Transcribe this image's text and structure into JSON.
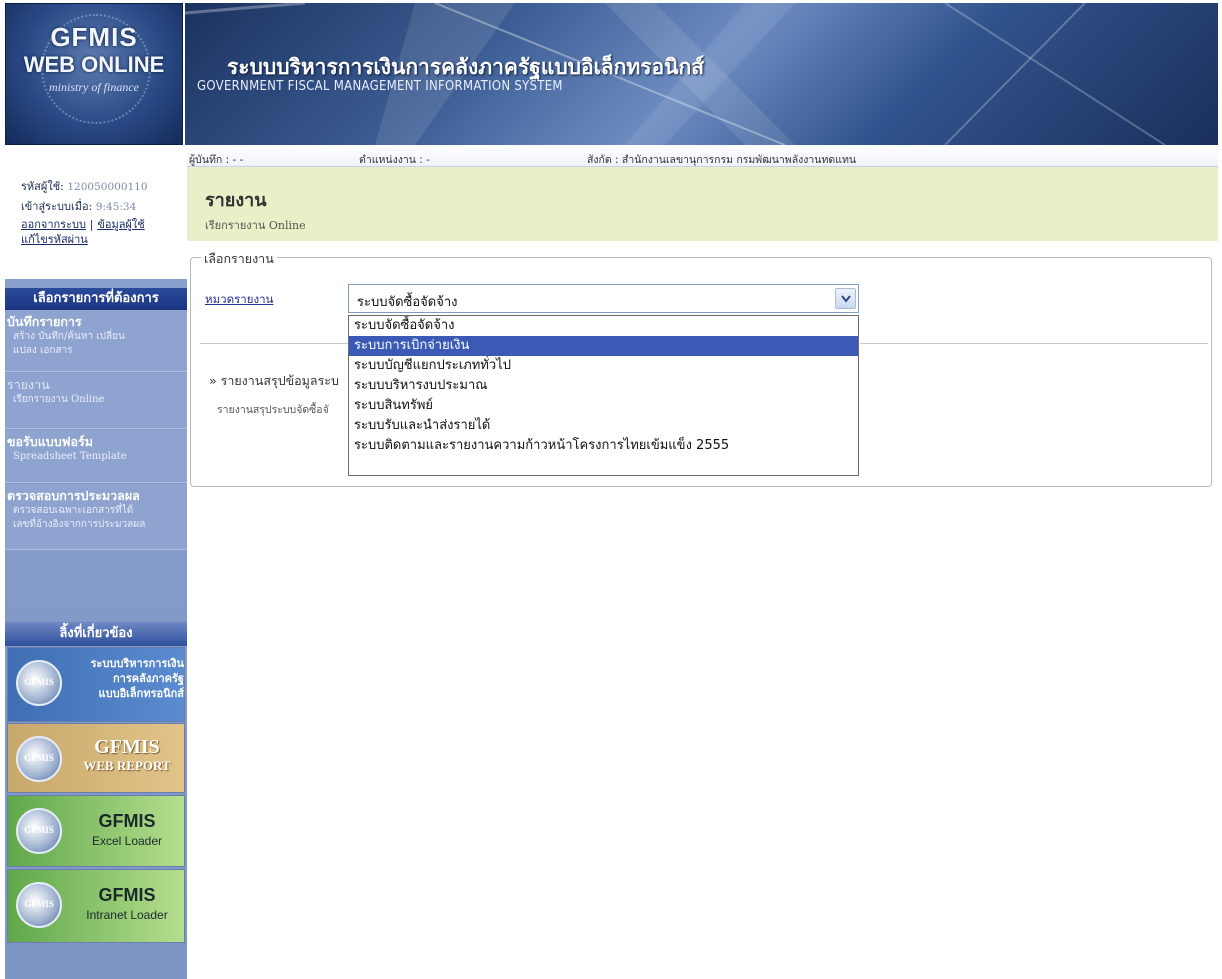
{
  "header": {
    "logo_line1": "GFMIS",
    "logo_line2": "WEB ONLINE",
    "logo_line3": "ministry of finance",
    "title_th": "ระบบบริหารการเงินการคลังภาครัฐแบบอิเล็กทรอนิกส์",
    "title_en": "GOVERNMENT FISCAL MANAGEMENT INFORMATION SYSTEM"
  },
  "user": {
    "user_id_label": "รหัสผู้ใช้:",
    "user_id": "120050000110",
    "login_time_label": "เข้าสู่ระบบเมื่อ:",
    "login_time": "9:45:34",
    "logout_link": "ออกจากระบบ",
    "separator": "|",
    "user_info_link": "ข้อมูลผู้ใช้",
    "change_password_link": "แก้ไขรหัสผ่าน"
  },
  "sidebar": {
    "menu_title": "เลือกรายการที่ต้องการ",
    "items": [
      {
        "title": "บันทึกรายการ",
        "desc1": "สร้าง บันทึก/ค้นหา เปลี่ยน",
        "desc2": "แปลง เอกสาร"
      },
      {
        "title": "รายงาน",
        "desc1": "เรียกรายงาน Online",
        "desc2": ""
      },
      {
        "title": "ขอรับแบบฟอร์ม",
        "desc1": "Spreadsheet Template",
        "desc2": ""
      },
      {
        "title": "ตรวจสอบการประมวลผล",
        "desc1": "ตรวจสอบเฉพาะเอกสารที่ได้",
        "desc2": "เลขที่อ้างอิงจากการประมวลผล"
      }
    ],
    "related_title": "ลิ้งที่เกี่ยวข้อง",
    "links": [
      {
        "badge": "GFMIS",
        "line1": "ระบบบริหารการเงิน",
        "line2": "การคลังภาครัฐ",
        "line3": "แบบอิเล็กทรอนิกส์"
      },
      {
        "badge": "GFMIS",
        "line1": "GFMIS",
        "line2": "WEB REPORT",
        "line3": ""
      },
      {
        "badge": "GFMIS",
        "line1": "GFMIS",
        "line2": "Excel Loader",
        "line3": ""
      },
      {
        "badge": "GFMIS",
        "line1": "GFMIS",
        "line2": "Intranet Loader",
        "line3": ""
      }
    ]
  },
  "infobar": {
    "recorder": "ผู้บันทึก : - -",
    "position": "ตำแหน่งงาน : -",
    "affiliation": "สังกัด : สำนักงานเลขานุการกรม กรมพัฒนาพลังงานทดแทน"
  },
  "page": {
    "title": "รายงาน",
    "subtitle": "เรียกรายงาน Online"
  },
  "form": {
    "legend": "เลือกรายงาน",
    "category_label": "หมวดรายงาน",
    "selected_value": "ระบบจัดซื้อจัดจ้าง",
    "options": [
      "ระบบจัดซื้อจัดจ้าง",
      "ระบบการเบิกจ่ายเงิน",
      "ระบบบัญชีแยกประเภททั่วไป",
      "ระบบบริหารงบประมาณ",
      "ระบบสินทรัพย์",
      "ระบบรับและนำส่งรายได้",
      "ระบบติดตามและรายงานความก้าวหน้าโครงการไทยเข้มแข็ง 2555"
    ],
    "highlighted_option": "ระบบการเบิกจ่ายเงิน",
    "report_link": "» รายงานสรุปข้อมูลระบ",
    "report_desc": "รายงานสรุประบบจัดซื้อจั"
  },
  "colors": {
    "sidebar_bg": "#8ea3cf",
    "section_title_bg": "#1b3582",
    "page_head_bg": "#e9f0c8",
    "option_highlight": "#3a5ab6"
  }
}
